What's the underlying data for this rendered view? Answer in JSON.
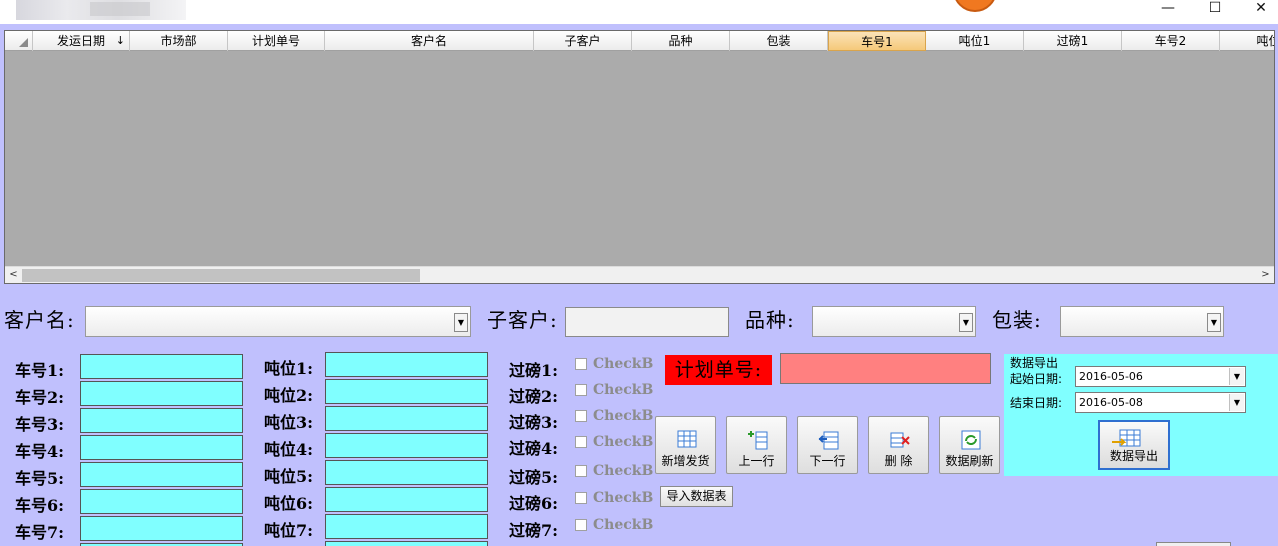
{
  "window": {
    "minimize": "—",
    "maximize": "☐",
    "close": "✕"
  },
  "grid": {
    "sort_indicator": "↓",
    "columns": [
      "发运日期",
      "市场部",
      "计划单号",
      "客户名",
      "子客户",
      "品种",
      "包装",
      "车号1",
      "吨位1",
      "过磅1",
      "车号2",
      "吨位"
    ],
    "selected_column": "车号1"
  },
  "filters": {
    "customer_label": "客户名:",
    "subcustomer_label": "子客户:",
    "variety_label": "品种:",
    "package_label": "包装:"
  },
  "vehicles": [
    "车号1:",
    "车号2:",
    "车号3:",
    "车号4:",
    "车号5:",
    "车号6:",
    "车号7:"
  ],
  "tonnages": [
    "吨位1:",
    "吨位2:",
    "吨位3:",
    "吨位4:",
    "吨位5:",
    "吨位6:",
    "吨位7:"
  ],
  "weighings": [
    "过磅1:",
    "过磅2:",
    "过磅3:",
    "过磅4:",
    "过磅5:",
    "过磅6:",
    "过磅7:"
  ],
  "checkbox_label": "CheckB",
  "plan_number_label": "计划单号:",
  "toolbar": {
    "add": "新增发货",
    "prev": "上一行",
    "next": "下一行",
    "delete": "删 除",
    "refresh": "数据刷新",
    "import": "导入数据表"
  },
  "export": {
    "title": "数据导出",
    "start_label": "起始日期:",
    "start_date": "2016-05-06",
    "end_label": "结束日期:",
    "end_date": "2016-05-08",
    "button": "数据导出"
  },
  "colors": {
    "accent_selected_header": "#f5c97a",
    "input_cyan": "#80ffff",
    "plan_label": "#ff0000",
    "plan_input": "#ff8080",
    "background": "#c0c0fd"
  }
}
